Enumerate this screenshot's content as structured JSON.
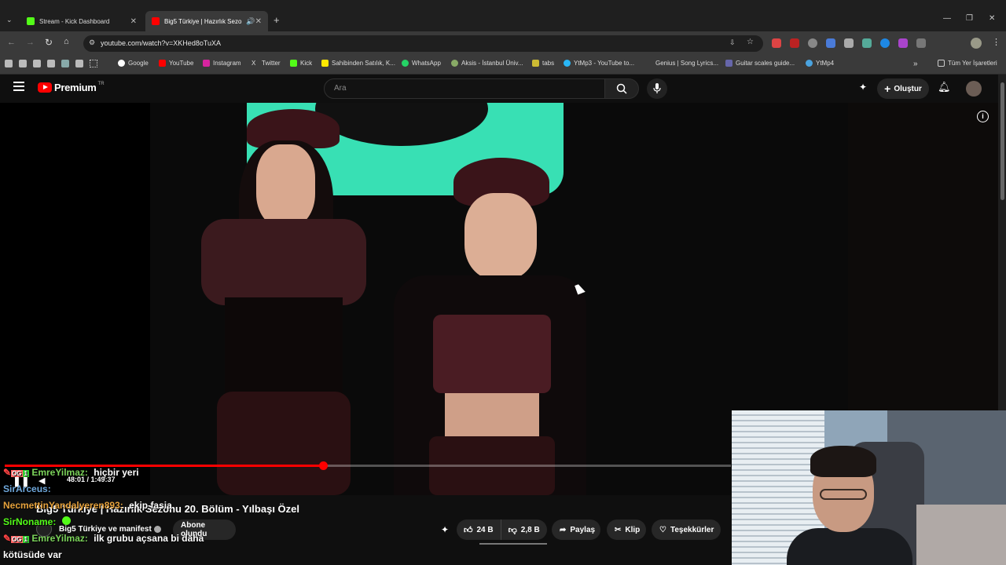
{
  "browser": {
    "tabs": [
      {
        "title": "Stream - Kick Dashboard",
        "active": false
      },
      {
        "title": "Big5 Türkiye | Hazırlık Sezo",
        "active": true
      }
    ],
    "url": "youtube.com/watch?v=XKHed8oTuXA",
    "bookmarks": [
      "Google",
      "YouTube",
      "Instagram",
      "Twitter",
      "Kick",
      "Sahibinden Satılık, K...",
      "WhatsApp",
      "Aksis - İstanbul Üniv...",
      "tabs",
      "YtMp3 - YouTube to...",
      "Genius | Song Lyrics...",
      "Guitar scales guide...",
      "YtMp4"
    ],
    "all_bookmarks": "Tüm Yer İşaretleri"
  },
  "youtube": {
    "logo": "Premium",
    "logo_region": "TR",
    "search_placeholder": "Ara",
    "create_label": "Oluştur",
    "video_title": "Big5 Türkiye | Hazırlık Sezonu 20. Bölüm - Yılbaşı Özel",
    "channel": "Big5 Türkiye ve manifest",
    "subscribe_label": "Abone olundu",
    "time": "48:01 / 1:49:37",
    "progress": 0.438,
    "likes": "24 B",
    "dislikes": "2,8 B",
    "share": "Paylaş",
    "clip": "Klip",
    "thanks": "Teşekkürler"
  },
  "chat": [
    {
      "user": "EmreYilmaz:",
      "msg": "hiçbir yeri",
      "color": "#7bd35a"
    },
    {
      "user": "SirArceus:",
      "msg": "",
      "color": "#6fa8dc"
    },
    {
      "user": "NecmettinYandalyeren893:",
      "msg": "ekip fasia",
      "color": "#e6a23c"
    },
    {
      "user": "SirNoname:",
      "msg": "",
      "color": "#53fc18"
    },
    {
      "user": "EmreYilmaz:",
      "msg": "ilk grubu açsana bi daha",
      "color": "#7bd35a"
    },
    {
      "user": "",
      "msg": "kötüsüde var",
      "color": "#ffffff"
    }
  ]
}
